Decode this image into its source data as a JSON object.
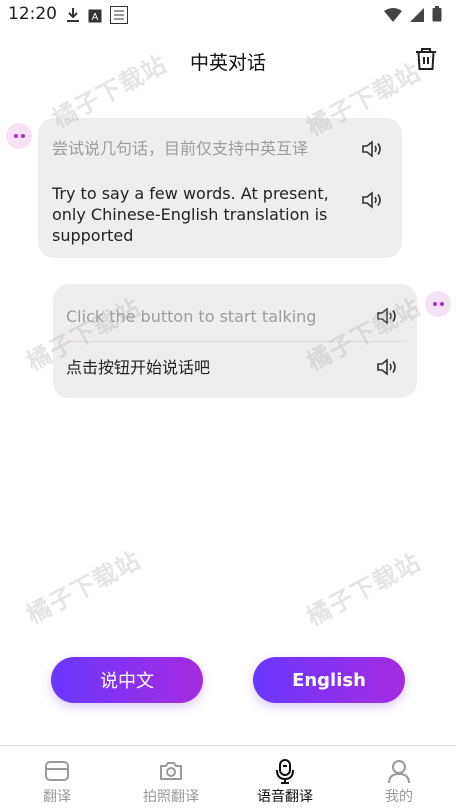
{
  "status_bar": {
    "time": "12:20"
  },
  "header": {
    "title": "中英对话"
  },
  "conversation": {
    "bubble_1": {
      "source_text": "尝试说几句话，目前仅支持中英互译",
      "translated_text": "Try to say a few words. At present, only Chinese-English translation is supported"
    },
    "bubble_2": {
      "source_text": "Click the button to start talking",
      "translated_text": "点击按钮开始说话吧"
    }
  },
  "actions": {
    "speak_chinese": "说中文",
    "speak_english": "English"
  },
  "watermark": {
    "text": "橘子下载站"
  },
  "bottom_nav": {
    "items": [
      {
        "label": "翻译",
        "icon": "folder-icon"
      },
      {
        "label": "拍照翻译",
        "icon": "camera-icon"
      },
      {
        "label": "语音翻译",
        "icon": "microphone-icon"
      },
      {
        "label": "我的",
        "icon": "user-icon"
      }
    ],
    "active_index": 2
  },
  "colors": {
    "accent_start": "#6a37ff",
    "accent_end": "#a52be0",
    "avatar_bg": "#f6e2f7",
    "bubble_bg": "#eeeeee"
  }
}
